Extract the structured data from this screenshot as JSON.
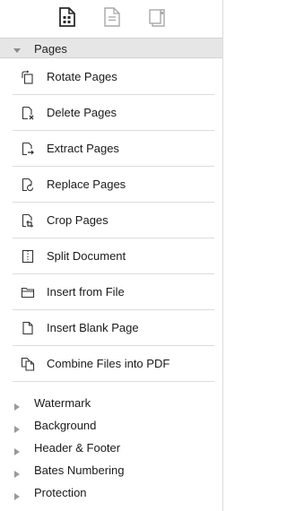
{
  "toolbar": {
    "icons": [
      "page-tools-icon",
      "document-icon",
      "page-export-icon"
    ]
  },
  "pages_section": {
    "label": "Pages",
    "expanded": true,
    "tools": [
      {
        "label": "Rotate Pages",
        "icon": "rotate-pages-icon"
      },
      {
        "label": "Delete Pages",
        "icon": "delete-pages-icon"
      },
      {
        "label": "Extract Pages",
        "icon": "extract-pages-icon"
      },
      {
        "label": "Replace Pages",
        "icon": "replace-pages-icon"
      },
      {
        "label": "Crop Pages",
        "icon": "crop-pages-icon"
      },
      {
        "label": "Split Document",
        "icon": "split-document-icon"
      },
      {
        "label": "Insert from File",
        "icon": "insert-from-file-icon"
      },
      {
        "label": "Insert Blank Page",
        "icon": "insert-blank-page-icon"
      },
      {
        "label": "Combine Files into PDF",
        "icon": "combine-files-icon"
      }
    ]
  },
  "collapsed_sections": [
    {
      "label": "Watermark"
    },
    {
      "label": "Background"
    },
    {
      "label": "Header & Footer"
    },
    {
      "label": "Bates Numbering"
    },
    {
      "label": "Protection"
    }
  ],
  "colors": {
    "header_bg": "#e6e6e6",
    "divider": "#dcdcdc",
    "icon_active": "#2b2b2b",
    "icon_inactive": "#a8a8a8"
  }
}
